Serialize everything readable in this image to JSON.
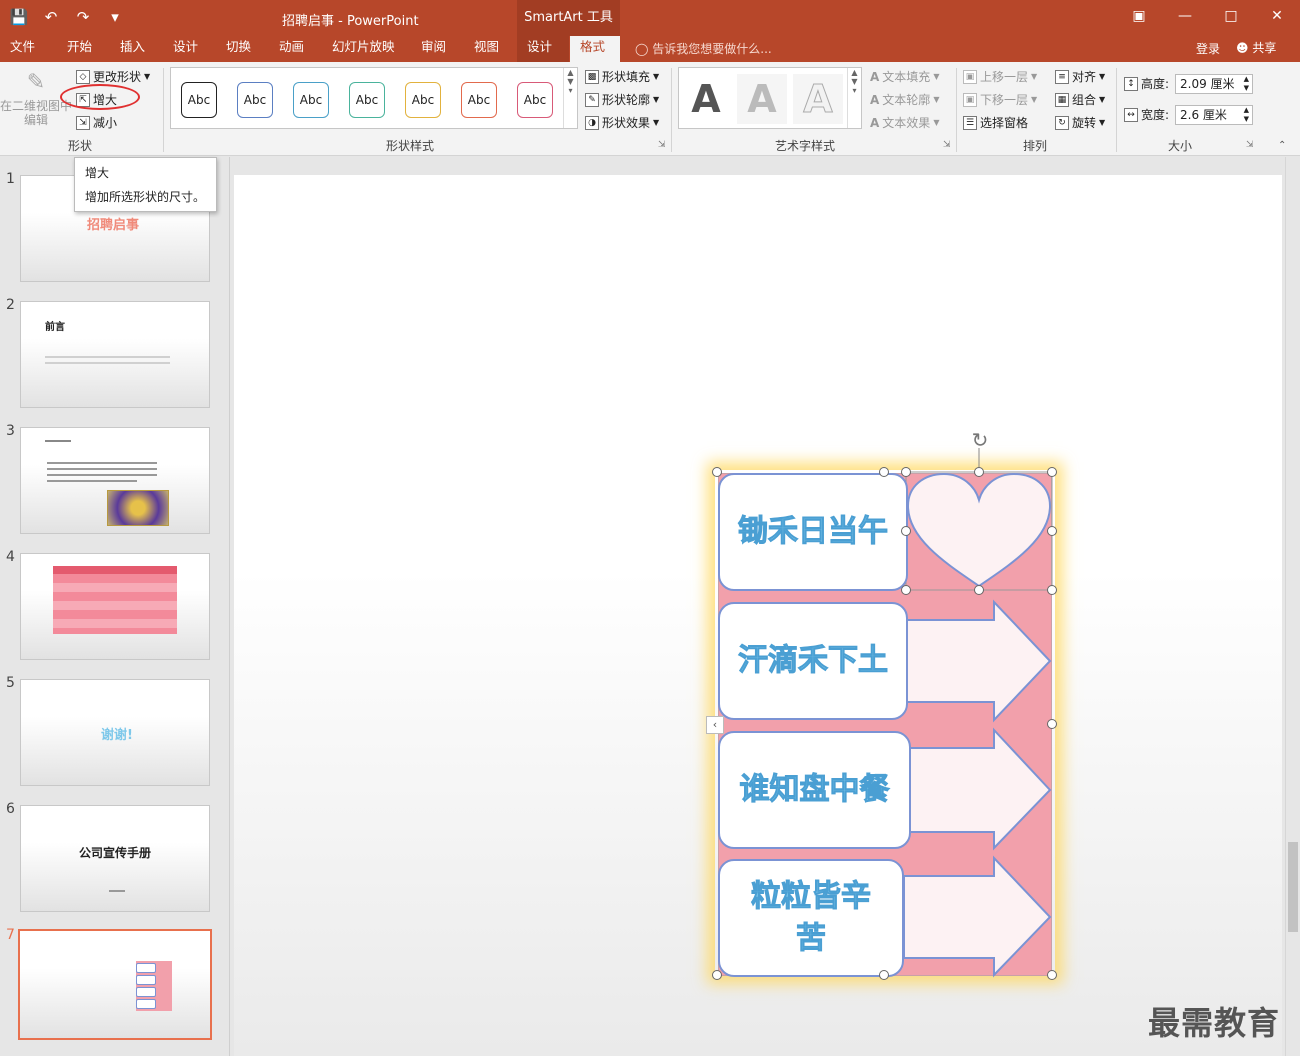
{
  "app": {
    "doc_title": "招聘启事 - PowerPoint",
    "context_tools": "SmartArt 工具",
    "login": "登录",
    "share": "共享",
    "tell_me": "告诉我您想要做什么..."
  },
  "tabs": [
    "文件",
    "开始",
    "插入",
    "设计",
    "切换",
    "动画",
    "幻灯片放映",
    "审阅",
    "视图",
    "设计",
    "格式"
  ],
  "ribbon": {
    "shape_group": {
      "edit_2d": "在二维视图中编辑",
      "change_shape": "更改形状",
      "enlarge": "增大",
      "shrink": "减小",
      "label": "形状"
    },
    "shape_styles": {
      "gallery": [
        "Abc",
        "Abc",
        "Abc",
        "Abc",
        "Abc",
        "Abc",
        "Abc"
      ],
      "fill": "形状填充",
      "outline": "形状轮廓",
      "effects": "形状效果",
      "label": "形状样式"
    },
    "wordart": {
      "samples": [
        "A",
        "A",
        "A"
      ],
      "text_fill": "文本填充",
      "text_outline": "文本轮廓",
      "text_effects": "文本效果",
      "label": "艺术字样式"
    },
    "arrange": {
      "bring_forward": "上移一层",
      "send_backward": "下移一层",
      "selection_pane": "选择窗格",
      "align": "对齐",
      "group": "组合",
      "rotate": "旋转",
      "label": "排列"
    },
    "size": {
      "height_label": "高度:",
      "height_value": "2.09 厘米",
      "width_label": "宽度:",
      "width_value": "2.6 厘米",
      "label": "大小"
    }
  },
  "tooltip": {
    "title": "增大",
    "description": "增加所选形状的尺寸。"
  },
  "slides": [
    {
      "num": "1",
      "text": "招聘启事"
    },
    {
      "num": "2",
      "text": "前言"
    },
    {
      "num": "3",
      "text": ""
    },
    {
      "num": "4",
      "text": ""
    },
    {
      "num": "5",
      "text": "谢谢!"
    },
    {
      "num": "6",
      "text": "公司宣传手册"
    },
    {
      "num": "7",
      "text": ""
    }
  ],
  "smartart": {
    "items": [
      "锄禾日当午",
      "汗滴禾下土",
      "谁知盘中餐",
      "粒粒皆辛苦"
    ]
  },
  "watermark": "最需教育",
  "colors": {
    "brand": "#b7472a",
    "smartart_bg": "#f2a0ab",
    "smartart_text": "#7ec8ea"
  }
}
